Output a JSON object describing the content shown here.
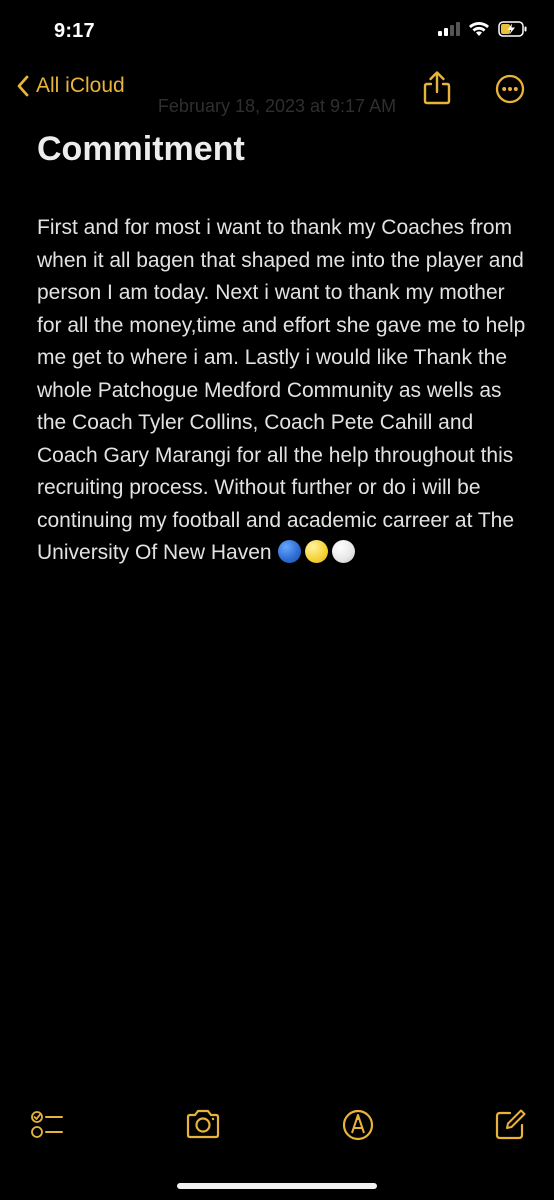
{
  "status_bar": {
    "time": "9:17",
    "signal_icon": "cellular-signal-icon",
    "wifi_icon": "wifi-icon",
    "battery_icon": "battery-charging-icon"
  },
  "nav": {
    "back_label": "All iCloud",
    "back_icon": "chevron-left-icon",
    "share_icon": "share-icon",
    "more_icon": "ellipsis-circle-icon"
  },
  "note": {
    "date": "February 18, 2023 at 9:17 AM",
    "title": "Commitment",
    "body": "First and for most i want to thank my Coaches from when it all bagen that shaped me into the player and person I am today. Next i want to thank my mother for all the money,time and effort she gave me to help me get to where i am. Lastly i would like Thank the whole Patchogue Medford Community as wells as the Coach Tyler Collins, Coach Pete Cahill and Coach Gary Marangi for all the help throughout this recruiting process. Without further or do i will be continuing my football and academic carreer at The University Of New Haven",
    "emojis": [
      "blue-circle",
      "yellow-circle",
      "white-circle"
    ]
  },
  "toolbar": {
    "checklist_icon": "checklist-icon",
    "camera_icon": "camera-icon",
    "markup_icon": "markup-pen-icon",
    "compose_icon": "compose-icon"
  },
  "colors": {
    "accent": "#E9B33A",
    "background": "#000000",
    "text": "#E2E2E2",
    "emoji_blue": "#2f6fd6",
    "emoji_yellow": "#f5d43b",
    "emoji_white": "#e6e6e6"
  }
}
